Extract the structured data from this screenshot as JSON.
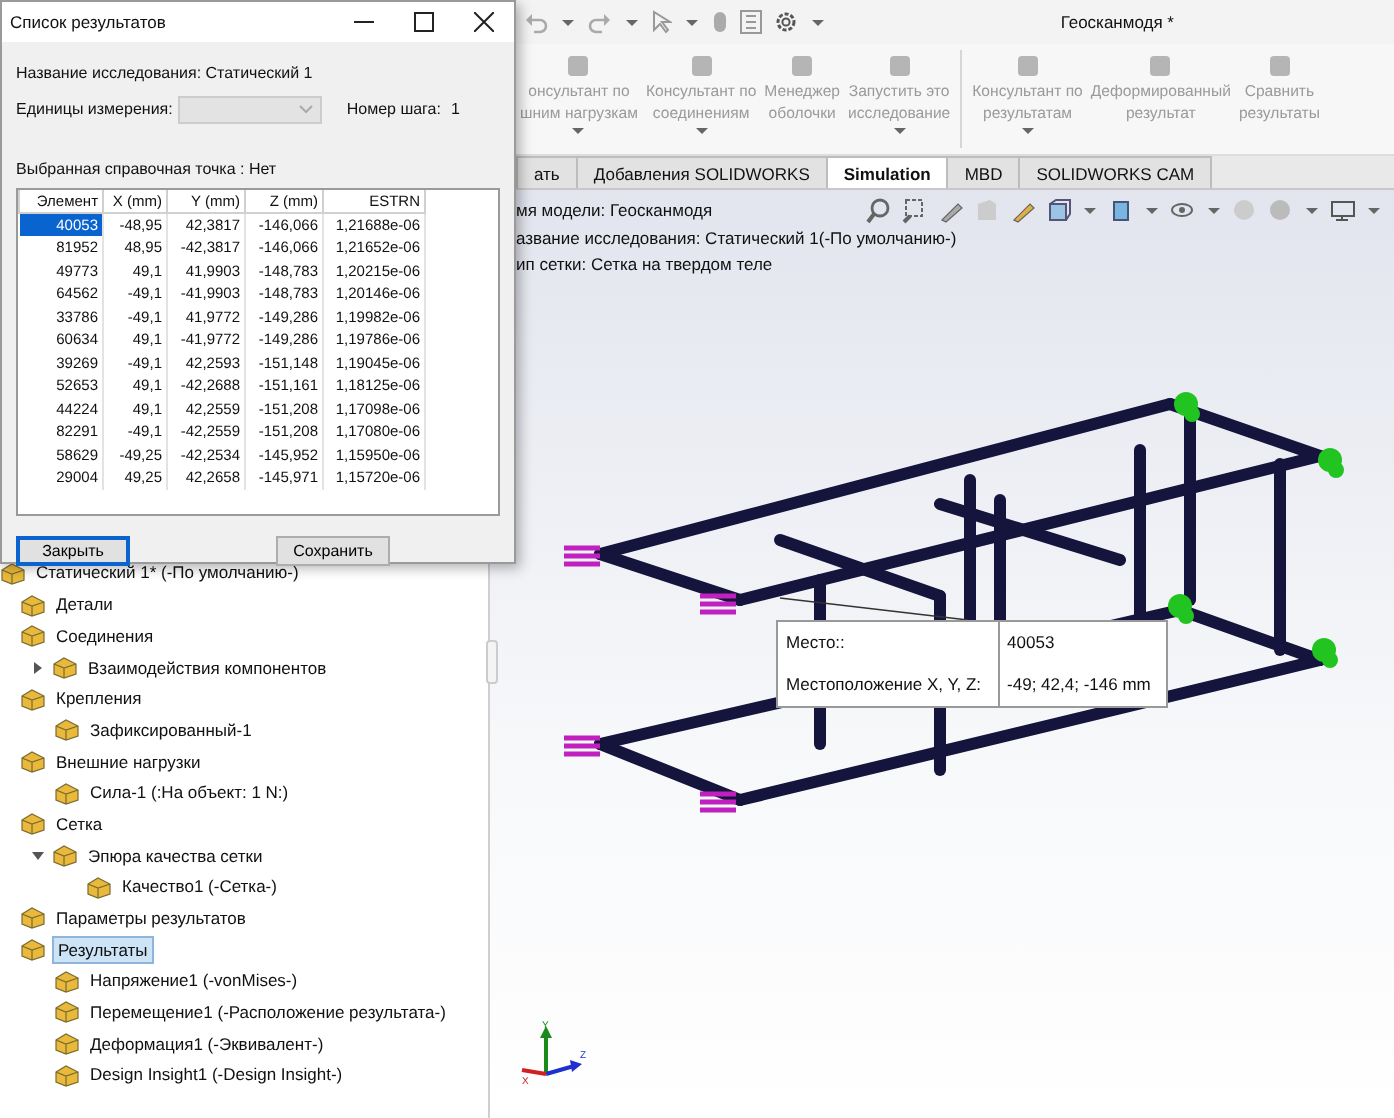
{
  "app": {
    "title": "Геосканмодя *"
  },
  "ribbon": {
    "buttons": [
      {
        "lines": [
          "онсультант по",
          "шним нагрузкам"
        ],
        "caret": true,
        "disabled": true
      },
      {
        "lines": [
          "Консультант по",
          "соединениям"
        ],
        "caret": true,
        "disabled": true
      },
      {
        "lines": [
          "Менеджер",
          "оболочки"
        ],
        "caret": false,
        "disabled": true
      },
      {
        "lines": [
          "Запустить это",
          "исследование"
        ],
        "caret": true,
        "disabled": true
      },
      {
        "lines": [
          "Консультант по",
          "результатам"
        ],
        "caret": true,
        "disabled": true
      },
      {
        "lines": [
          "Деформированный",
          "результат"
        ],
        "caret": false,
        "disabled": true
      },
      {
        "lines": [
          "Сравнить",
          "результаты"
        ],
        "caret": false,
        "disabled": true
      }
    ]
  },
  "tabs": [
    {
      "label": "ать",
      "selected": false
    },
    {
      "label": "Добавления SOLIDWORKS",
      "selected": false
    },
    {
      "label": "Simulation",
      "selected": true
    },
    {
      "label": "MBD",
      "selected": false
    },
    {
      "label": "SOLIDWORKS CAM",
      "selected": false
    }
  ],
  "tree": {
    "root": {
      "label": "Статический 1* (-По умолчанию-)",
      "children": [
        {
          "label": "Детали",
          "selected": false
        },
        {
          "label": "Соединения",
          "selected": false,
          "children": [
            {
              "label": "Взаимодействия компонентов",
              "expanded": false
            }
          ]
        },
        {
          "label": "Крепления",
          "selected": false,
          "children": [
            {
              "label": "Зафиксированный-1"
            }
          ]
        },
        {
          "label": "Внешние нагрузки",
          "selected": false,
          "children": [
            {
              "label": "Сила-1 (:На объект: 1 N:)"
            }
          ]
        },
        {
          "label": "Сетка",
          "selected": false,
          "children": [
            {
              "label": "Эпюра качества сетки",
              "expanded": true,
              "children": [
                {
                  "label": "Качество1 (-Сетка-)"
                }
              ]
            }
          ]
        },
        {
          "label": "Параметры результатов",
          "selected": false
        },
        {
          "label": "Результаты",
          "selected": true,
          "children": [
            {
              "label": "Напряжение1 (-vonMises-)"
            },
            {
              "label": "Перемещение1 (-Расположение результата-)"
            },
            {
              "label": "Деформация1 (-Эквивалент-)"
            },
            {
              "label": "Design Insight1 (-Design Insight-)"
            }
          ]
        }
      ]
    }
  },
  "viewport": {
    "info": [
      "мя модели: Геосканмодя",
      "азвание исследования: Статический 1(-По умолчанию-)",
      "ип сетки: Сетка на твердом теле"
    ],
    "probe": [
      {
        "label": "Место::",
        "value": "40053"
      },
      {
        "label": "Местоположение X, Y, Z:",
        "value": "-49; 42,4; -146 mm"
      }
    ],
    "triad": {
      "x": "X",
      "y": "Y",
      "z": "Z"
    }
  },
  "dialog": {
    "title": "Список результатов",
    "study": "Название исследования: Статический 1",
    "units_label": "Единицы измерения:",
    "units_disabled": true,
    "step_label": "Номер шага:",
    "step": "1",
    "reference": "Выбранная справочная точка : Нет",
    "table": {
      "columns": [
        "Элемент",
        "X (mm)",
        "Y (mm)",
        "Z (mm)",
        "ESTRN"
      ],
      "rows": [
        {
          "cells": [
            "40053",
            "-48,95",
            "42,3817",
            "-146,066",
            "1,21688e-06"
          ],
          "selected": true
        },
        {
          "cells": [
            "81952",
            "48,95",
            "-42,3817",
            "-146,066",
            "1,21652e-06"
          ],
          "selected": false
        },
        {
          "cells": [
            "49773",
            "49,1",
            "41,9903",
            "-148,783",
            "1,20215e-06"
          ],
          "selected": false
        },
        {
          "cells": [
            "64562",
            "-49,1",
            "-41,9903",
            "-148,783",
            "1,20146e-06"
          ],
          "selected": false
        },
        {
          "cells": [
            "33786",
            "-49,1",
            "41,9772",
            "-149,286",
            "1,19982e-06"
          ],
          "selected": false
        },
        {
          "cells": [
            "60634",
            "49,1",
            "-41,9772",
            "-149,286",
            "1,19786e-06"
          ],
          "selected": false
        },
        {
          "cells": [
            "39269",
            "-49,1",
            "42,2593",
            "-151,148",
            "1,19045e-06"
          ],
          "selected": false
        },
        {
          "cells": [
            "52653",
            "49,1",
            "-42,2688",
            "-151,161",
            "1,18125e-06"
          ],
          "selected": false
        },
        {
          "cells": [
            "44224",
            "49,1",
            "42,2559",
            "-151,208",
            "1,17098e-06"
          ],
          "selected": false
        },
        {
          "cells": [
            "82291",
            "-49,1",
            "-42,2559",
            "-151,208",
            "1,17080e-06"
          ],
          "selected": false
        },
        {
          "cells": [
            "58629",
            "-49,25",
            "-42,2534",
            "-145,952",
            "1,15950e-06"
          ],
          "selected": false
        },
        {
          "cells": [
            "29004",
            "49,25",
            "42,2658",
            "-145,971",
            "1,15720e-06"
          ],
          "selected": false
        }
      ]
    },
    "buttons": [
      {
        "label": "Закрыть",
        "focused": true
      },
      {
        "label": "Сохранить",
        "focused": false
      }
    ]
  }
}
